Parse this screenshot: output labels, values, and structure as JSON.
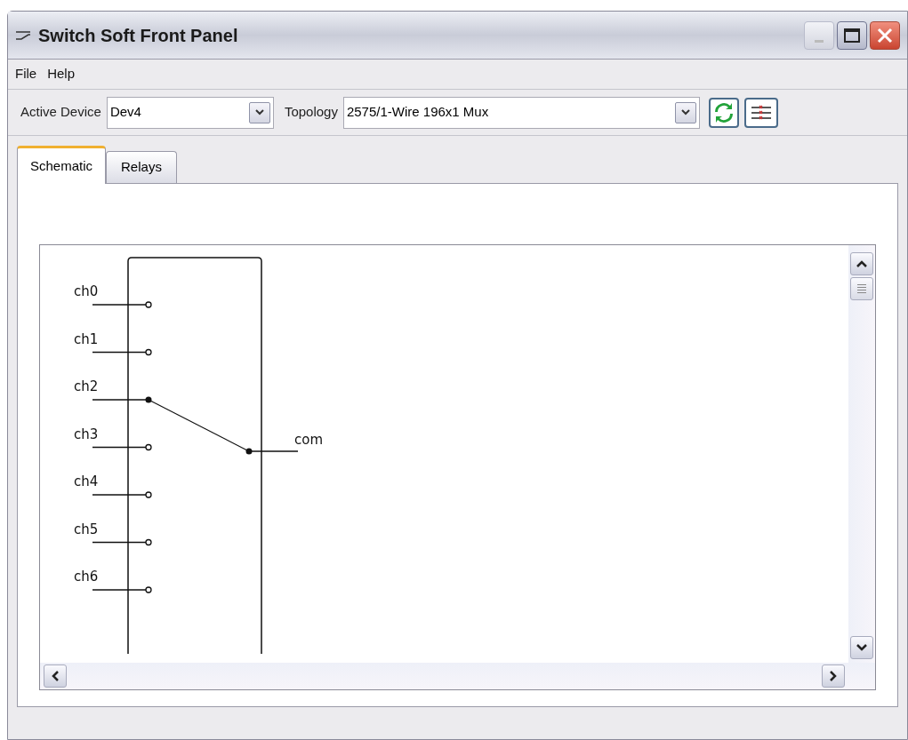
{
  "window": {
    "title": "Switch Soft Front Panel"
  },
  "menu": [
    "File",
    "Help"
  ],
  "toolbar": {
    "device_label": "Active Device",
    "device_value": "Dev4",
    "topology_label": "Topology",
    "topology_value": "2575/1-Wire 196x1 Mux"
  },
  "tabs": [
    {
      "label": "Schematic",
      "selected": true
    },
    {
      "label": "Relays",
      "selected": false
    }
  ],
  "schematic": {
    "channels": [
      {
        "name": "ch0",
        "closed": false
      },
      {
        "name": "ch1",
        "closed": false
      },
      {
        "name": "ch2",
        "closed": true
      },
      {
        "name": "ch3",
        "closed": false
      },
      {
        "name": "ch4",
        "closed": false
      },
      {
        "name": "ch5",
        "closed": false
      },
      {
        "name": "ch6",
        "closed": false
      }
    ],
    "common": "com"
  }
}
